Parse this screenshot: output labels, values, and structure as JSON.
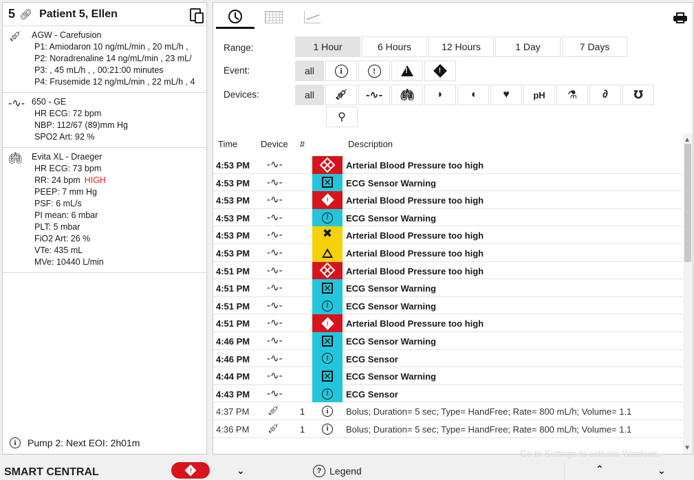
{
  "patient": {
    "bed": "5",
    "name": "Patient 5, Ellen"
  },
  "devices": [
    {
      "icon": "syringe-icon",
      "name": "AGW - Carefusion",
      "lines": [
        "P1: Amiodaron 10 ng/mL/min , 20 mL/h ,",
        "P2: Noradrenaline 14 ng/mL/min , 23 mL/",
        "P3:  , 45 mL/h ,  , 00:21:00 minutes",
        "P4: Frusemide 12 ng/mL/min , 22 mL/h , 4"
      ]
    },
    {
      "icon": "ecg-icon",
      "name": "650 - GE",
      "lines": [
        "HR ECG: 72 bpm",
        "NBP: 112/67 (89)mm Hg",
        "SPO2 Art: 92 %"
      ]
    },
    {
      "icon": "lungs-icon",
      "name": "Evita XL - Draeger",
      "lines": [
        "HR ECG: 73 bpm",
        "RR: 24 bpm",
        "PEEP:  7 mm Hg",
        "PSF: 6 mL/s",
        "PI mean: 6 mbar",
        "PLT: 5 mbar",
        "FiO2 Art: 26 %",
        "VTe: 435 mL",
        "MVe: 10440 L/min"
      ],
      "flag_line_index": 1,
      "flag": "HIGH"
    }
  ],
  "next_eoi": "Pump 2: Next EOI: 2h01m",
  "filters": {
    "range_label": "Range:",
    "range_options": [
      "1 Hour",
      "6 Hours",
      "12 Hours",
      "1 Day",
      "7 Days"
    ],
    "range_selected": "1 Hour",
    "event_label": "Event:",
    "event_all": "all",
    "devices_label": "Devices:",
    "devices_all": "all",
    "device_icons": [
      "syringe-icon",
      "ecg-icon",
      "lungs-icon",
      "kidney-pump-icon",
      "kidney-icon",
      "heart-icon",
      "ph-icon",
      "flask-icon",
      "tube-icon",
      "stethoscope-icon",
      "person-icon"
    ],
    "ph_text": "pH"
  },
  "table": {
    "headers": {
      "time": "Time",
      "device": "Device",
      "num": "#",
      "description": "Description"
    },
    "rows": [
      {
        "time": "4:53 PM",
        "sev": "red-cross",
        "desc": "Arterial Blood Pressure too high",
        "bold": true
      },
      {
        "time": "4:53 PM",
        "sev": "cyan-xbox",
        "desc": "ECG Sensor Warning",
        "bold": true
      },
      {
        "time": "4:53 PM",
        "sev": "red-diamond",
        "desc": "Arterial Blood Pressure too high",
        "bold": true
      },
      {
        "time": "4:53 PM",
        "sev": "cyan-circle",
        "desc": "ECG Sensor Warning",
        "bold": true
      },
      {
        "time": "4:53 PM",
        "sev": "yellow-xbox",
        "desc": "Arterial Blood Pressure too high",
        "bold": true
      },
      {
        "time": "4:53 PM",
        "sev": "yellow-triangle",
        "desc": "Arterial Blood Pressure too high",
        "bold": true
      },
      {
        "time": "4:51 PM",
        "sev": "red-cross",
        "desc": "Arterial Blood Pressure too high",
        "bold": true
      },
      {
        "time": "4:51 PM",
        "sev": "cyan-xbox",
        "desc": "ECG Sensor Warning",
        "bold": true
      },
      {
        "time": "4:51 PM",
        "sev": "cyan-circle",
        "desc": "ECG Sensor Warning",
        "bold": true
      },
      {
        "time": "4:51 PM",
        "sev": "red-diamond",
        "desc": "Arterial Blood Pressure too high",
        "bold": true
      },
      {
        "time": "4:46 PM",
        "sev": "cyan-xbox",
        "desc": "ECG Sensor Warning",
        "bold": true
      },
      {
        "time": "4:46 PM",
        "sev": "cyan-circle",
        "desc": "ECG Sensor",
        "bold": true
      },
      {
        "time": "4:44 PM",
        "sev": "cyan-xbox",
        "desc": "ECG Sensor Warning",
        "bold": true
      },
      {
        "time": "4:43 PM",
        "sev": "cyan-circle",
        "desc": "ECG Sensor",
        "bold": true
      },
      {
        "time": "4:37 PM",
        "sev": "info",
        "device": "syringe",
        "num": "1",
        "desc": "Bolus; Duration= 5 sec; Type= HandFree; Rate= 800 mL/h; Volume= 1.1",
        "bold": false
      },
      {
        "time": "4:36 PM",
        "sev": "info",
        "device": "syringe",
        "num": "1",
        "desc": "Bolus; Duration= 5 sec; Type= HandFree; Rate= 800 mL/h; Volume= 1.1",
        "bold": false
      }
    ]
  },
  "bottom": {
    "brand": "SMART CENTRAL",
    "legend": "Legend",
    "watermark": "Go to Settings to activate Windows."
  },
  "colors": {
    "red": "#d7141c",
    "cyan": "#22c5dc",
    "yellow": "#f5d10a"
  }
}
